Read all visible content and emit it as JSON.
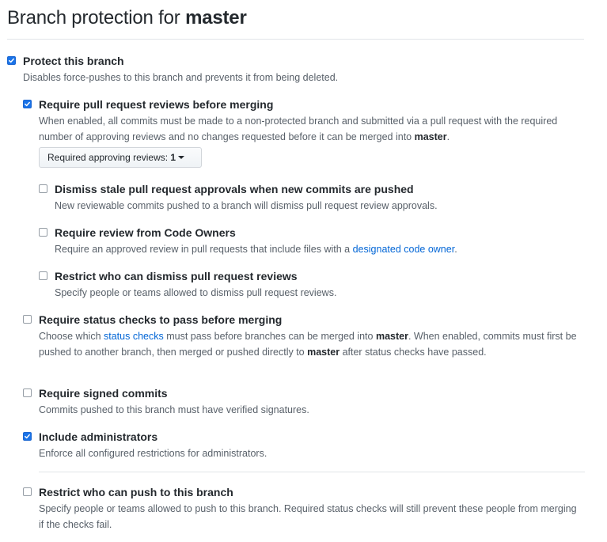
{
  "title": {
    "prefix": "Branch protection for ",
    "branch": "master"
  },
  "options": {
    "protect": {
      "label": "Protect this branch",
      "note": "Disables force-pushes to this branch and prevents it from being deleted.",
      "checked": true
    },
    "require_reviews": {
      "label": "Require pull request reviews before merging",
      "note_1": "When enabled, all commits must be made to a non-protected branch and submitted via a pull request with the required number of approving reviews and no changes requested before it can be merged into ",
      "note_branch": "master",
      "note_2": ".",
      "checked": true,
      "select_label": "Required approving reviews: ",
      "select_value": "1"
    },
    "dismiss_stale": {
      "label": "Dismiss stale pull request approvals when new commits are pushed",
      "note": "New reviewable commits pushed to a branch will dismiss pull request review approvals.",
      "checked": false
    },
    "code_owners": {
      "label": "Require review from Code Owners",
      "note_1": "Require an approved review in pull requests that include files with a ",
      "note_link": "designated code owner",
      "note_2": ".",
      "checked": false
    },
    "restrict_dismiss": {
      "label": "Restrict who can dismiss pull request reviews",
      "note": "Specify people or teams allowed to dismiss pull request reviews.",
      "checked": false
    },
    "status_checks": {
      "label": "Require status checks to pass before merging",
      "note_1": "Choose which ",
      "note_link": "status checks",
      "note_2": " must pass before branches can be merged into ",
      "note_branch_1": "master",
      "note_3": ". When enabled, commits must first be pushed to another branch, then merged or pushed directly to ",
      "note_branch_2": "master",
      "note_4": " after status checks have passed.",
      "checked": false
    },
    "signed_commits": {
      "label": "Require signed commits",
      "note": "Commits pushed to this branch must have verified signatures.",
      "checked": false
    },
    "include_admins": {
      "label": "Include administrators",
      "note": "Enforce all configured restrictions for administrators.",
      "checked": true
    },
    "restrict_push": {
      "label": "Restrict who can push to this branch",
      "note": "Specify people or teams allowed to push to this branch. Required status checks will still prevent these people from merging if the checks fail.",
      "checked": false
    }
  },
  "colors": {
    "checkbox_checked": "#1a73e8",
    "link": "#0366d6",
    "note_text": "#586069",
    "heading_text": "#24292e",
    "divider": "#e1e4e8"
  }
}
